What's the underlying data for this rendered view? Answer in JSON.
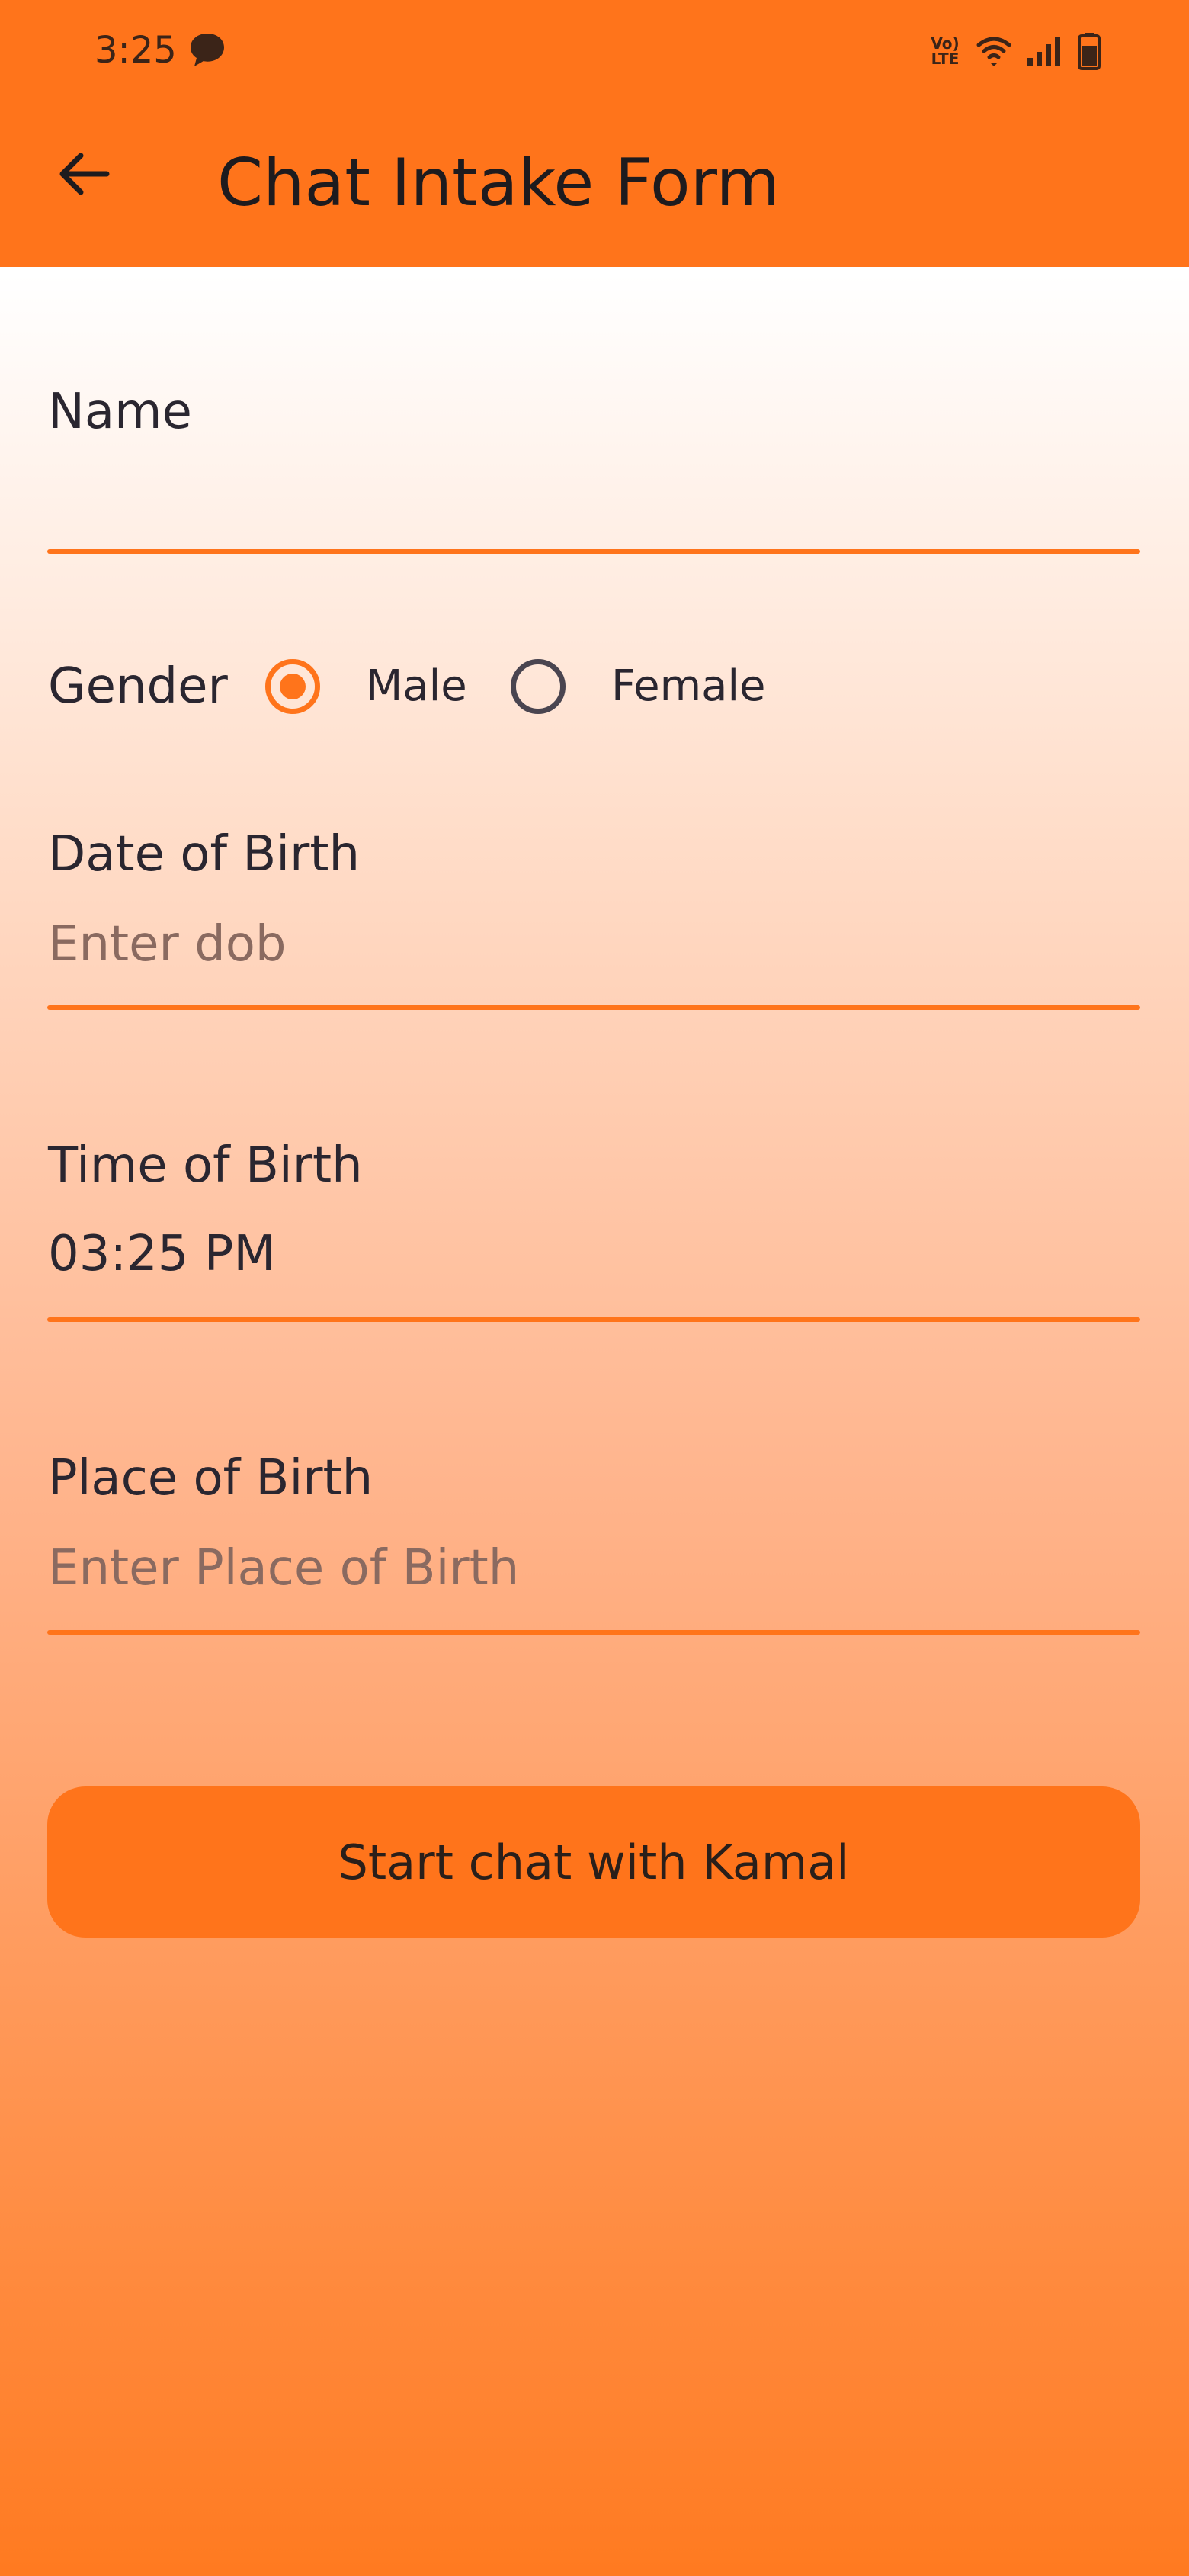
{
  "status_bar": {
    "time": "3:25",
    "volte_label": "Vo) LTE",
    "icons": [
      "chat-bubble-icon",
      "volte-icon",
      "wifi-icon",
      "signal-icon",
      "battery-icon"
    ]
  },
  "app_bar": {
    "back_icon": "arrow-left-icon",
    "title": "Chat Intake Form"
  },
  "form": {
    "name": {
      "label": "Name",
      "value": "",
      "placeholder": ""
    },
    "gender": {
      "label": "Gender",
      "options": [
        {
          "label": "Male",
          "selected": true
        },
        {
          "label": "Female",
          "selected": false
        }
      ]
    },
    "dob": {
      "label": "Date of Birth",
      "value": "",
      "placeholder": "Enter dob"
    },
    "tob": {
      "label": "Time of Birth",
      "value": "03:25 PM"
    },
    "pob": {
      "label": "Place of Birth",
      "value": "",
      "placeholder": "Enter Place of Birth"
    },
    "submit_label": "Start chat with Kamal"
  },
  "colors": {
    "accent": "#ff741b",
    "text": "#2a2630",
    "placeholder": "#8a6a60"
  }
}
